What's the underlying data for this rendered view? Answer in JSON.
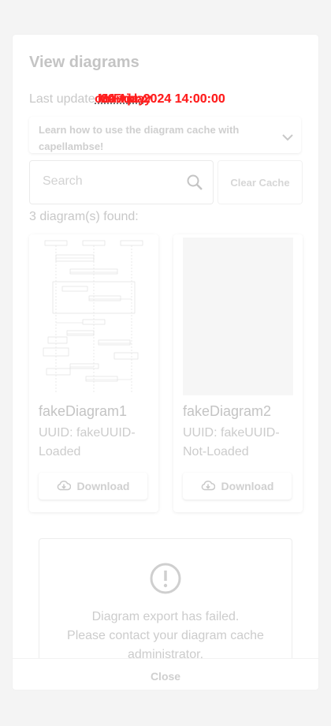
{
  "dialog": {
    "title": "View diagrams",
    "last_updated_label": "Last updated:",
    "overlap_texts": [
      "Monday",
      "29 Apr 2024 14:00:00",
      "on Friday",
      "04 Apr 2024 14:00:00"
    ],
    "expander_text": "Learn how to use the diagram cache with capellambse!",
    "search": {
      "placeholder": "Search",
      "value": ""
    },
    "clear_cache_label": "Clear Cache",
    "found_text": "3 diagram(s) found:",
    "diagrams": [
      {
        "name": "fakeDiagram1",
        "uuid": "UUID: fakeUUID-Loaded",
        "download_label": "Download",
        "loaded": true
      },
      {
        "name": "fakeDiagram2",
        "uuid": "UUID: fakeUUID-Not-Loaded",
        "download_label": "Download",
        "loaded": false
      }
    ],
    "error": {
      "line1": "Diagram export has failed.",
      "line2": "Please contact your diagram cache",
      "line3": "administrator."
    },
    "close_label": "Close"
  },
  "colors": {
    "overlay_text": "#ff1f1f",
    "muted_text": "#c8c8c8",
    "background": "#f4f4f4"
  },
  "icons": [
    "chevron-down-icon",
    "search-icon",
    "cloud-download-icon",
    "error-circle-icon"
  ]
}
